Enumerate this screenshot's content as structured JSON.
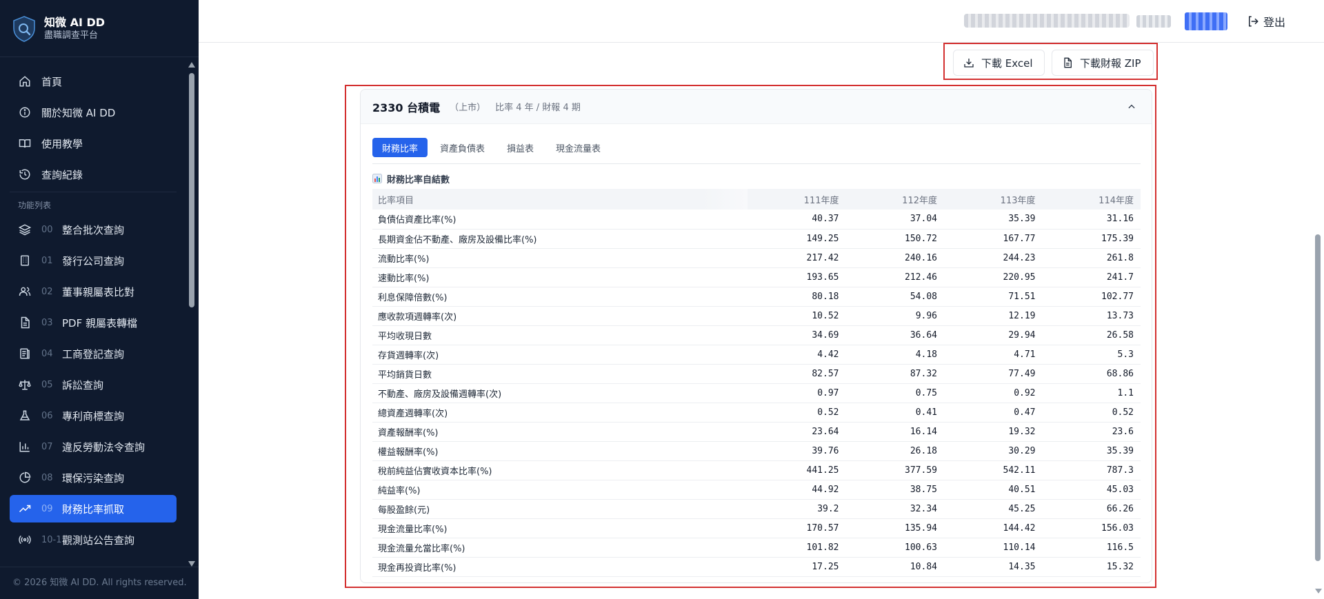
{
  "brand": {
    "title": "知微 AI DD",
    "subtitle": "盡職調查平台"
  },
  "nav": {
    "main": [
      {
        "label": "首頁",
        "icon": "home-icon"
      },
      {
        "label": "關於知微 AI DD",
        "icon": "info-icon"
      },
      {
        "label": "使用教學",
        "icon": "book-icon"
      },
      {
        "label": "查詢紀錄",
        "icon": "history-icon"
      }
    ],
    "section_label": "功能列表",
    "features": [
      {
        "num": "00",
        "label": "整合批次查詢",
        "icon": "layers-icon"
      },
      {
        "num": "01",
        "label": "發行公司查詢",
        "icon": "building-icon"
      },
      {
        "num": "02",
        "label": "董事親屬表比對",
        "icon": "users-icon"
      },
      {
        "num": "03",
        "label": "PDF 親屬表轉檔",
        "icon": "file-icon"
      },
      {
        "num": "04",
        "label": "工商登記查詢",
        "icon": "register-icon"
      },
      {
        "num": "05",
        "label": "訴訟查詢",
        "icon": "scale-icon"
      },
      {
        "num": "06",
        "label": "專利商標查詢",
        "icon": "flask-icon"
      },
      {
        "num": "07",
        "label": "違反勞動法令查詢",
        "icon": "bar-chart-icon"
      },
      {
        "num": "08",
        "label": "環保污染查詢",
        "icon": "pie-chart-icon"
      },
      {
        "num": "09",
        "label": "財務比率抓取",
        "icon": "trending-up-icon",
        "active": true
      },
      {
        "num": "10-1",
        "label": "觀測站公告查詢",
        "icon": "broadcast-icon"
      }
    ],
    "footer": "© 2026 知微 AI DD. All rights reserved."
  },
  "header": {
    "logout_label": "登出"
  },
  "toolbar": {
    "excel_label": "下載 Excel",
    "zip_label": "下載財報 ZIP"
  },
  "card": {
    "title": "2330 台積電",
    "tag": "（上市）",
    "meta": "比率 4 年 / 財報 4 期",
    "tabs": [
      "財務比率",
      "資產負債表",
      "損益表",
      "現金流量表"
    ],
    "active_tab": 0,
    "section_title": "財務比率自結數",
    "table": {
      "headers": [
        "比率項目",
        "111年度",
        "112年度",
        "113年度",
        "114年度"
      ],
      "rows": [
        [
          "負債佔資產比率(%)",
          "40.37",
          "37.04",
          "35.39",
          "31.16"
        ],
        [
          "長期資金佔不動產、廠房及設備比率(%)",
          "149.25",
          "150.72",
          "167.77",
          "175.39"
        ],
        [
          "流動比率(%)",
          "217.42",
          "240.16",
          "244.23",
          "261.8"
        ],
        [
          "速動比率(%)",
          "193.65",
          "212.46",
          "220.95",
          "241.7"
        ],
        [
          "利息保障倍數(%)",
          "80.18",
          "54.08",
          "71.51",
          "102.77"
        ],
        [
          "應收款項週轉率(次)",
          "10.52",
          "9.96",
          "12.19",
          "13.73"
        ],
        [
          "平均收現日數",
          "34.69",
          "36.64",
          "29.94",
          "26.58"
        ],
        [
          "存貨週轉率(次)",
          "4.42",
          "4.18",
          "4.71",
          "5.3"
        ],
        [
          "平均銷貨日數",
          "82.57",
          "87.32",
          "77.49",
          "68.86"
        ],
        [
          "不動產、廠房及設備週轉率(次)",
          "0.97",
          "0.75",
          "0.92",
          "1.1"
        ],
        [
          "總資產週轉率(次)",
          "0.52",
          "0.41",
          "0.47",
          "0.52"
        ],
        [
          "資產報酬率(%)",
          "23.64",
          "16.14",
          "19.32",
          "23.6"
        ],
        [
          "權益報酬率(%)",
          "39.76",
          "26.18",
          "30.29",
          "35.39"
        ],
        [
          "稅前純益佔實收資本比率(%)",
          "441.25",
          "377.59",
          "542.11",
          "787.3"
        ],
        [
          "純益率(%)",
          "44.92",
          "38.75",
          "40.51",
          "45.03"
        ],
        [
          "每股盈餘(元)",
          "39.2",
          "32.34",
          "45.25",
          "66.26"
        ],
        [
          "現金流量比率(%)",
          "170.57",
          "135.94",
          "144.42",
          "156.03"
        ],
        [
          "現金流量允當比率(%)",
          "101.82",
          "100.63",
          "110.14",
          "116.5"
        ],
        [
          "現金再投資比率(%)",
          "17.25",
          "10.84",
          "14.35",
          "15.32"
        ]
      ]
    }
  },
  "colors": {
    "sidebar_bg": "#0f1a2e",
    "accent": "#2563eb",
    "highlight_border": "#d32f2f"
  }
}
